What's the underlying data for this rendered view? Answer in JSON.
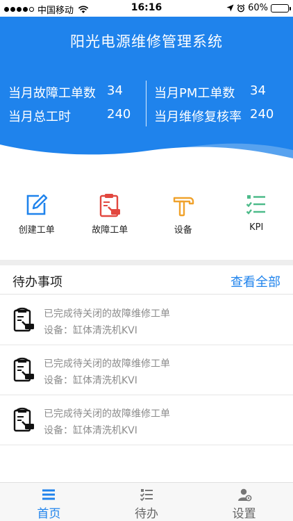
{
  "status_bar": {
    "carrier": "中国移动",
    "time": "16:16",
    "battery_percent": "60%",
    "battery_level": 0.6,
    "signal_bars_filled": 4
  },
  "header": {
    "title": "阳光电源维修管理系统",
    "stats": [
      {
        "label": "当月故障工单数",
        "value": "34"
      },
      {
        "label": "当月总工时",
        "value": "240"
      },
      {
        "label": "当月PM工单数",
        "value": "34"
      },
      {
        "label": "当月维修复核率",
        "value": "240"
      }
    ]
  },
  "actions": [
    {
      "label": "创建工单",
      "icon": "edit-icon"
    },
    {
      "label": "故障工单",
      "icon": "fault-order-icon"
    },
    {
      "label": "设备",
      "icon": "hammer-icon"
    },
    {
      "label": "KPI",
      "icon": "checklist-icon"
    }
  ],
  "todo": {
    "title": "待办事项",
    "view_all": "查看全部",
    "items": [
      {
        "line1": "已完成待关闭的故障维修工单",
        "line2": "设备：缸体清洗机KVI"
      },
      {
        "line1": "已完成待关闭的故障维修工单",
        "line2": "设备：缸体清洗机KVI"
      },
      {
        "line1": "已完成待关闭的故障维修工单",
        "line2": "设备：缸体清洗机KVI"
      }
    ]
  },
  "tabbar": {
    "tabs": [
      {
        "label": "首页",
        "icon": "home-list-icon",
        "active": true
      },
      {
        "label": "待办",
        "icon": "todo-list-icon",
        "active": false
      },
      {
        "label": "设置",
        "icon": "settings-user-icon",
        "active": false
      }
    ]
  },
  "colors": {
    "primary": "#1f83ec",
    "fault_red": "#e2473f",
    "equipment_orange": "#f0a22c",
    "kpi_green": "#4dbb8a"
  }
}
